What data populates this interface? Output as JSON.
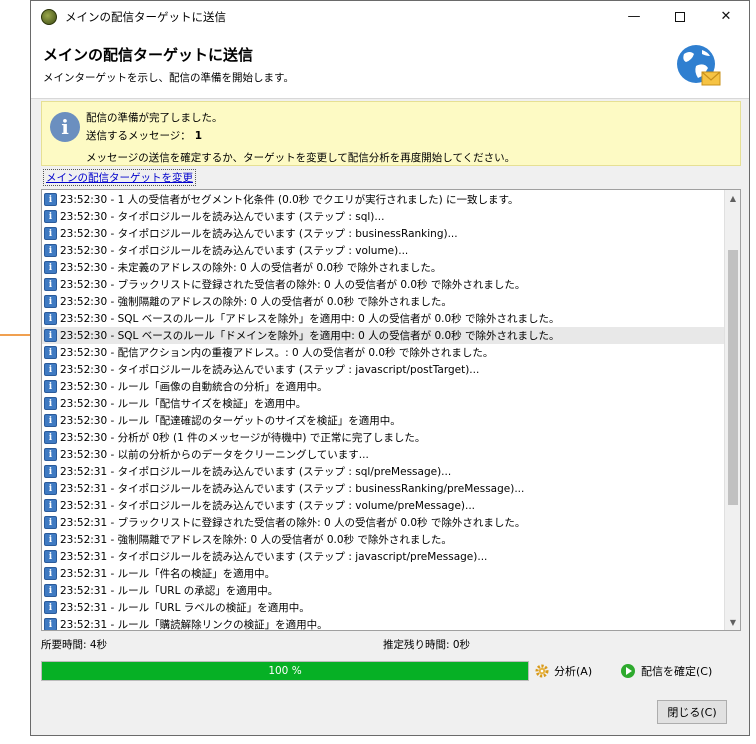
{
  "window": {
    "title": "メインの配信ターゲットに送信",
    "minimize": "—",
    "close": "✕"
  },
  "header": {
    "title": "メインの配信ターゲットに送信",
    "subtitle": "メインターゲットを示し、配信の準備を開始します。"
  },
  "info": {
    "icon": "i",
    "ready": "配信の準備が完了しました。",
    "messages_label": "送信するメッセージ：",
    "messages_count": "1",
    "confirm": "メッセージの送信を確定するか、ターゲットを変更して配信分析を再度開始してください。"
  },
  "change_target_link": "メインの配信ターゲットを変更",
  "log": {
    "selected_index": 8,
    "rows": [
      "23:52:30 - 1 人の受信者がセグメント化条件 (0.0秒 でクエリが実行されました) に一致します。",
      "23:52:30 - タイポロジルールを読み込んでいます (ステップ : sql)...",
      "23:52:30 - タイポロジルールを読み込んでいます (ステップ : businessRanking)...",
      "23:52:30 - タイポロジルールを読み込んでいます (ステップ : volume)...",
      "23:52:30 - 未定義のアドレスの除外: 0 人の受信者が 0.0秒 で除外されました。",
      "23:52:30 - ブラックリストに登録された受信者の除外: 0 人の受信者が 0.0秒 で除外されました。",
      "23:52:30 - 強制隔離のアドレスの除外: 0 人の受信者が 0.0秒 で除外されました。",
      "23:52:30 - SQL ベースのルール「アドレスを除外」を適用中: 0 人の受信者が 0.0秒 で除外されました。",
      "23:52:30 - SQL ベースのルール「ドメインを除外」を適用中: 0 人の受信者が 0.0秒 で除外されました。",
      "23:52:30 - 配信アクション内の重複アドレス。: 0 人の受信者が 0.0秒 で除外されました。",
      "23:52:30 - タイポロジルールを読み込んでいます (ステップ : javascript/postTarget)...",
      "23:52:30 - ルール「画像の自動統合の分析」を適用中。",
      "23:52:30 - ルール「配信サイズを検証」を適用中。",
      "23:52:30 - ルール「配達確認のターゲットのサイズを検証」を適用中。",
      "23:52:30 - 分析が 0秒 (1 件のメッセージが待機中) で正常に完了しました。",
      "23:52:30 - 以前の分析からのデータをクリーニングしています...",
      "23:52:31 - タイポロジルールを読み込んでいます (ステップ : sql/preMessage)...",
      "23:52:31 - タイポロジルールを読み込んでいます (ステップ : businessRanking/preMessage)...",
      "23:52:31 - タイポロジルールを読み込んでいます (ステップ : volume/preMessage)...",
      "23:52:31 - ブラックリストに登録された受信者の除外: 0 人の受信者が 0.0秒 で除外されました。",
      "23:52:31 - 強制隔離でアドレスを除外: 0 人の受信者が 0.0秒 で除外されました。",
      "23:52:31 - タイポロジルールを読み込んでいます (ステップ : javascript/preMessage)...",
      "23:52:31 - ルール「件名の検証」を適用中。",
      "23:52:31 - ルール「URL の承認」を適用中。",
      "23:52:31 - ルール「URL ラベルの検証」を適用中。",
      "23:52:31 - ルール「購読解除リンクの検証」を適用中。"
    ]
  },
  "status": {
    "elapsed": "所要時間:  4秒",
    "remaining": "推定残り時間:  0秒"
  },
  "progress": {
    "percent": 100,
    "label": "100 %",
    "color": "#06b025"
  },
  "buttons": {
    "analyze": "分析(A)",
    "confirm": "配信を確定(C)",
    "close": "閉じる(C)"
  },
  "icons": {
    "app": "app-logo-icon",
    "globe": "globe-mail-icon",
    "info": "info-icon",
    "gear": "gear-icon",
    "play": "play-icon"
  }
}
